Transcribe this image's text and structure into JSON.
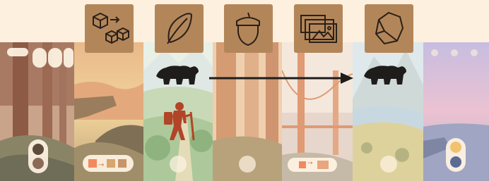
{
  "colors": {
    "background": "#fdf0de",
    "tile": "#b3865a",
    "icon_stroke": "#2a2018",
    "bear": "#1f1d1b",
    "hiker": "#b24427",
    "arrow": "#1f1d1b",
    "token_orange": "#f08a5d",
    "token_tan": "#b89b7a"
  },
  "icons": [
    "resources-to-cubes-icon",
    "leaf-icon",
    "acorn-icon",
    "landscape-photos-icon",
    "stone-icon"
  ],
  "panels": [
    "redwood-forest",
    "canyon-sunset",
    "mountain-meadow",
    "redwood-trunks",
    "golden-gate-bridge",
    "mountain-lake",
    "twilight-coast"
  ],
  "figures": [
    "bear-icon",
    "hiker-icon",
    "bear-icon"
  ]
}
